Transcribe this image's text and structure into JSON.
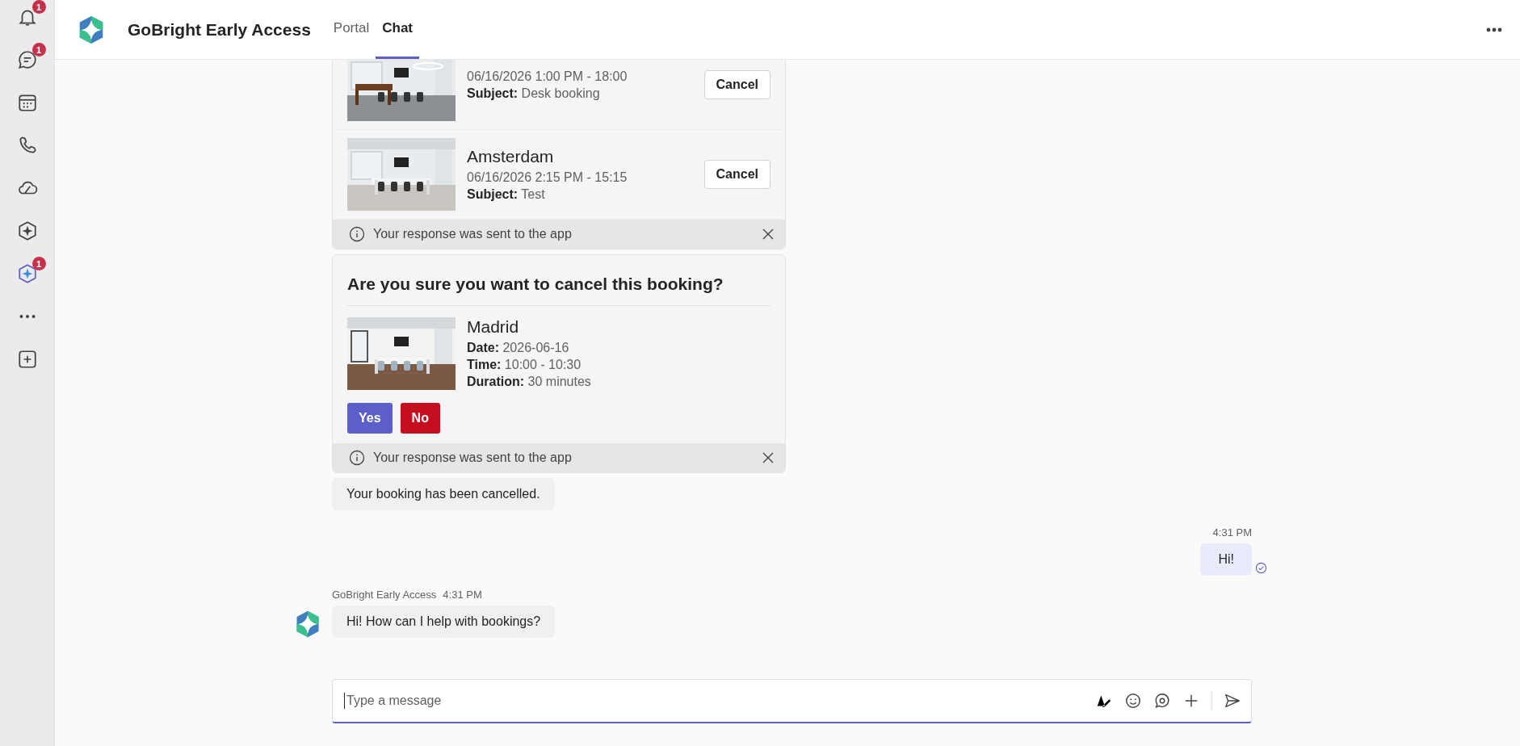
{
  "app_rail": [
    {
      "kind": "bell",
      "badge": "1",
      "selected": false
    },
    {
      "kind": "chat",
      "badge": "1",
      "selected": false
    },
    {
      "kind": "calendar",
      "selected": false
    },
    {
      "kind": "phone",
      "selected": false
    },
    {
      "kind": "cloud",
      "selected": false
    },
    {
      "kind": "copilot",
      "selected": false
    },
    {
      "kind": "app",
      "badge": "1",
      "selected": true
    },
    {
      "kind": "more",
      "selected": false
    },
    {
      "kind": "add",
      "selected": false
    }
  ],
  "header": {
    "title": "GoBright Early Access",
    "tabs": [
      {
        "label": "Portal",
        "selected": false
      },
      {
        "label": "Chat",
        "selected": true
      }
    ]
  },
  "messages": [
    {
      "kind": "booking_list",
      "bookings": [
        {
          "datetime": "06/16/2026 1:00 PM - 18:00",
          "subject_label": "Subject:",
          "subject": "Desk booking",
          "action": "Cancel"
        },
        {
          "title": "Amsterdam",
          "datetime": "06/16/2026 2:15 PM - 15:15",
          "subject_label": "Subject:",
          "subject": "Test",
          "action": "Cancel"
        }
      ],
      "notice": "Your response was sent to the app"
    },
    {
      "kind": "confirm",
      "title": "Are you sure you want to cancel this booking?",
      "booking": {
        "title": "Madrid",
        "fields": [
          {
            "label": "Date:",
            "value": "2026-06-16"
          },
          {
            "label": "Time:",
            "value": "10:00 - 10:30"
          },
          {
            "label": "Duration:",
            "value": "30 minutes"
          }
        ]
      },
      "buttons": [
        {
          "label": "Yes",
          "kind": "primary"
        },
        {
          "label": "No",
          "kind": "danger"
        }
      ],
      "notice": "Your response was sent to the app"
    },
    {
      "kind": "received",
      "text": "Your booking has been cancelled."
    },
    {
      "kind": "sent",
      "time": "4:31 PM",
      "text": "Hi!"
    },
    {
      "kind": "received",
      "sender": "GoBright Early Access",
      "time": "4:31 PM",
      "text": "Hi! How can I help with bookings?"
    }
  ],
  "composer": {
    "placeholder": "Type a message"
  }
}
